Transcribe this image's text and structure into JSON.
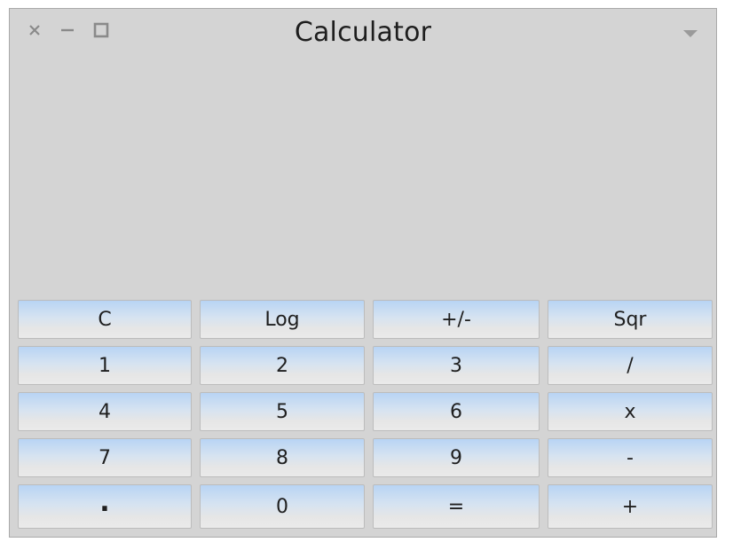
{
  "window": {
    "title": "Calculator"
  },
  "titlebar": {
    "close_icon": "close-icon",
    "minimize_icon": "minimize-icon",
    "maximize_icon": "maximize-icon",
    "menu_icon": "chevron-down-icon"
  },
  "display": {
    "value": ""
  },
  "keypad": {
    "rows": [
      [
        "C",
        "Log",
        "+/-",
        "Sqr"
      ],
      [
        "1",
        "2",
        "3",
        "/"
      ],
      [
        "4",
        "5",
        "6",
        "x"
      ],
      [
        "7",
        "8",
        "9",
        "-"
      ],
      [
        ".",
        "0",
        "=",
        "+"
      ]
    ]
  },
  "colors": {
    "window_bg": "#d4d4d4",
    "button_top": "#b8d4f4",
    "button_bottom": "#eaeaea",
    "text": "#1e1e1e"
  }
}
